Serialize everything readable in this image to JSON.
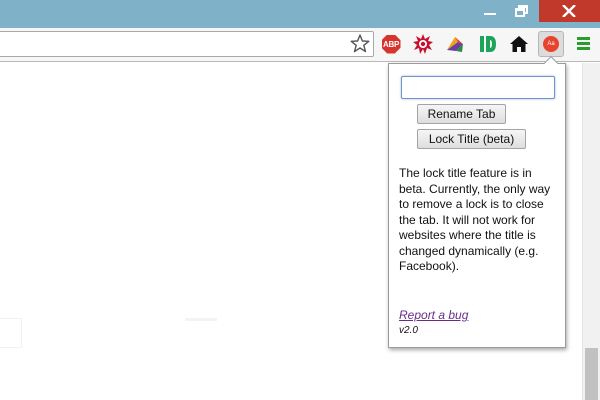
{
  "popup": {
    "title_value": "",
    "rename_button": "Rename Tab",
    "lock_button": "Lock Title (beta)",
    "info_text": "The lock title feature is in beta. Currently, the only way to remove a lock is to close the tab. It will not work for websites where the title is changed dynamically (e.g. Facebook).",
    "bug_link": "Report a bug",
    "version": "v2.0"
  },
  "toolbar": {
    "abp_icon_text": "ABP",
    "extension_icon_text": "Aa"
  },
  "colors": {
    "titlebar": "#7fb1c9",
    "close_button": "#c0392b",
    "menu_icon": "#2a9d2a",
    "link": "#6a2c8a"
  },
  "icons": [
    "minimize-icon",
    "maximize-icon",
    "close-icon",
    "star-icon",
    "adblock-plus-icon",
    "burst-icon",
    "bird-icon",
    "ip-icon",
    "home-icon",
    "rename-tab-extension-icon",
    "menu-icon"
  ]
}
